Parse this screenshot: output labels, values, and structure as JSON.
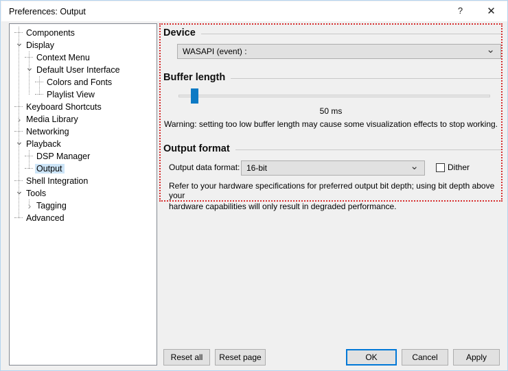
{
  "window": {
    "title": "Preferences: Output",
    "help_icon": "question-mark-icon",
    "close_icon": "close-icon"
  },
  "sidebar": {
    "items": [
      {
        "label": "Components",
        "depth": 0,
        "state": "leaf",
        "selected": false
      },
      {
        "label": "Display",
        "depth": 0,
        "state": "open",
        "selected": false
      },
      {
        "label": "Context Menu",
        "depth": 1,
        "state": "leaf",
        "selected": false
      },
      {
        "label": "Default User Interface",
        "depth": 1,
        "state": "open",
        "selected": false
      },
      {
        "label": "Colors and Fonts",
        "depth": 2,
        "state": "leaf",
        "selected": false
      },
      {
        "label": "Playlist View",
        "depth": 2,
        "state": "leaf",
        "selected": false
      },
      {
        "label": "Keyboard Shortcuts",
        "depth": 0,
        "state": "leaf",
        "selected": false
      },
      {
        "label": "Media Library",
        "depth": 0,
        "state": "closed",
        "selected": false
      },
      {
        "label": "Networking",
        "depth": 0,
        "state": "leaf",
        "selected": false
      },
      {
        "label": "Playback",
        "depth": 0,
        "state": "open",
        "selected": false
      },
      {
        "label": "DSP Manager",
        "depth": 1,
        "state": "leaf",
        "selected": false
      },
      {
        "label": "Output",
        "depth": 1,
        "state": "leaf",
        "selected": true
      },
      {
        "label": "Shell Integration",
        "depth": 0,
        "state": "leaf",
        "selected": false
      },
      {
        "label": "Tools",
        "depth": 0,
        "state": "open",
        "selected": false
      },
      {
        "label": "Tagging",
        "depth": 1,
        "state": "closed",
        "selected": false
      },
      {
        "label": "Advanced",
        "depth": 0,
        "state": "leaf",
        "selected": false
      }
    ]
  },
  "device_group": {
    "title": "Device",
    "dropdown_value": "WASAPI (event) :"
  },
  "buffer_group": {
    "title": "Buffer length",
    "value_label": "50 ms",
    "slider_percent": 4,
    "warning": "Warning: setting too low buffer length may cause some visualization effects to stop working."
  },
  "output_format_group": {
    "title": "Output format",
    "format_label": "Output data format:",
    "format_value": "16-bit",
    "dither_label": "Dither",
    "dither_checked": false,
    "hint_line1": "Refer to your hardware specifications for preferred output bit depth; using bit depth above your",
    "hint_line2": "hardware capabilities will only result in degraded performance."
  },
  "footer": {
    "reset_all": "Reset all",
    "reset_page": "Reset page",
    "ok": "OK",
    "cancel": "Cancel",
    "apply": "Apply"
  },
  "colors": {
    "accent": "#0078d7",
    "slider_thumb": "#0d7ac4",
    "highlight_box": "#d62b2b",
    "selection": "#cce4f7"
  }
}
